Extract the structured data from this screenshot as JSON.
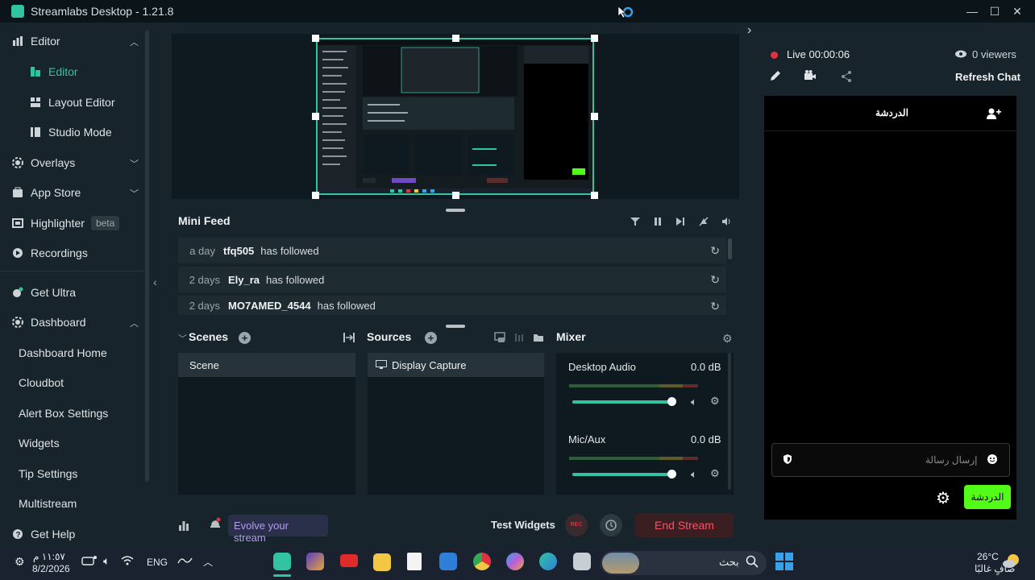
{
  "app": {
    "title": "Streamlabs Desktop - 1.21.8",
    "accent": "#31c3a2"
  },
  "sidebar": {
    "items": [
      {
        "label": "Editor",
        "icon": "editor-icon",
        "expanded": true
      },
      {
        "label": "Editor",
        "icon": "editor-active-icon",
        "active": true
      },
      {
        "label": "Layout Editor",
        "icon": "layout-icon"
      },
      {
        "label": "Studio Mode",
        "icon": "studio-mode-icon"
      },
      {
        "label": "Overlays",
        "icon": "overlays-icon"
      },
      {
        "label": "App Store",
        "icon": "app-store-icon"
      },
      {
        "label": "Highlighter",
        "icon": "highlighter-icon",
        "badge": "beta"
      },
      {
        "label": "Recordings",
        "icon": "recordings-icon"
      },
      {
        "label": "Get Ultra",
        "icon": "ultra-icon"
      },
      {
        "label": "Dashboard",
        "icon": "dashboard-icon",
        "expanded": true
      },
      {
        "label": "Dashboard Home"
      },
      {
        "label": "Cloudbot"
      },
      {
        "label": "Alert Box Settings"
      },
      {
        "label": "Widgets"
      },
      {
        "label": "Tip Settings"
      },
      {
        "label": "Multistream"
      },
      {
        "label": "Get Help",
        "icon": "help-icon"
      }
    ]
  },
  "mini_feed": {
    "title": "Mini Feed",
    "events": [
      {
        "time": "a day",
        "user": "tfq505",
        "action": "has followed"
      },
      {
        "time": "2 days",
        "user": "Ely_ra",
        "action": "has followed"
      },
      {
        "time": "2 days",
        "user": "MO7AMED_4544",
        "action": "has followed"
      }
    ]
  },
  "scenes": {
    "title": "Scenes",
    "items": [
      "Scene"
    ]
  },
  "sources": {
    "title": "Sources",
    "items": [
      "Display Capture"
    ]
  },
  "mixer": {
    "title": "Mixer",
    "channels": [
      {
        "name": "Desktop Audio",
        "db": "0.0 dB",
        "volume": 1.0
      },
      {
        "name": "Mic/Aux",
        "db": "0.0 dB",
        "volume": 1.0
      }
    ]
  },
  "footer": {
    "evolve": "Evolve your stream",
    "test_widgets": "Test Widgets",
    "rec_label": "REC",
    "end_stream": "End Stream"
  },
  "live": {
    "status": "Live 00:00:06",
    "viewers": "0 viewers",
    "refresh_chat": "Refresh Chat",
    "chat_tab": "الدردشة",
    "chat_placeholder": "إرسال رسالة",
    "chat_send": "الدردشة"
  },
  "taskbar": {
    "time": "١١:٥٧ م",
    "date": "8/2/2026",
    "lang": "ENG",
    "search": "بحث",
    "weather_temp": "26°C",
    "weather_desc": "صافٍ غالبًا"
  }
}
